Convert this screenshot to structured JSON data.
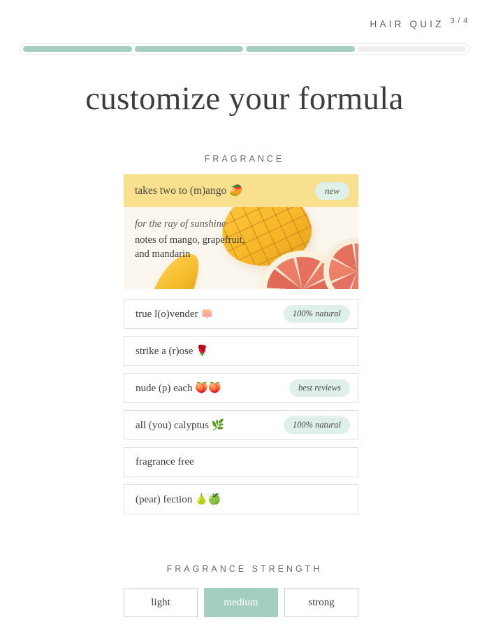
{
  "header": {
    "quiz_label": "HAIR QUIZ",
    "step_label": "3 / 4",
    "progress": {
      "total_steps": 4,
      "completed_steps": 3,
      "fill_color": "#a5cec2",
      "empty_color": "#eeeeee"
    }
  },
  "page_title": "customize your formula",
  "fragrance_section": {
    "label": "FRAGRANCE",
    "featured": {
      "title": "takes two to (m)ango 🥭",
      "badge": "new",
      "tagline": "for the ray of sunshine",
      "notes": "notes of mango, grapefruit, and mandarin",
      "header_color": "#f8e08e",
      "body_color": "#faf8f2",
      "image_alt": "cubed mango and sliced grapefruit"
    },
    "options": [
      {
        "label": "true l(o)vender 🪷",
        "badge": "100% natural"
      },
      {
        "label": "strike a (r)ose 🌹",
        "badge": ""
      },
      {
        "label": "nude (p) each 🍑🍑",
        "badge": "best reviews"
      },
      {
        "label": "all (you) calyptus 🌿",
        "badge": "100% natural"
      },
      {
        "label": "fragrance free",
        "badge": ""
      },
      {
        "label": "(pear) fection 🍐🍏",
        "badge": ""
      }
    ]
  },
  "strength_section": {
    "label": "FRAGRANCE STRENGTH",
    "options": [
      {
        "label": "light",
        "selected": false
      },
      {
        "label": "medium",
        "selected": true
      },
      {
        "label": "strong",
        "selected": false
      }
    ],
    "selected_color": "#a5cec2"
  }
}
